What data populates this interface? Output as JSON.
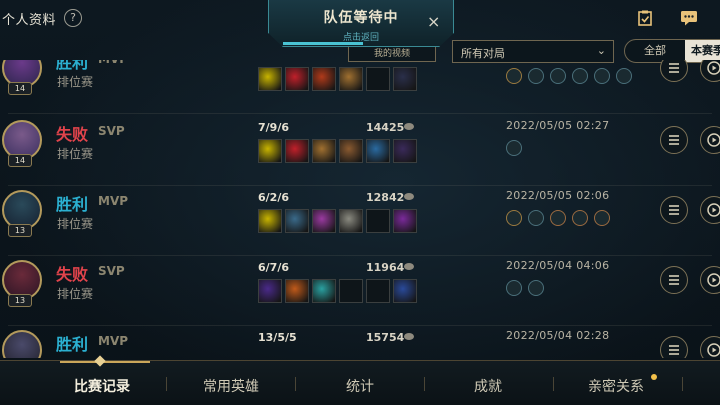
{
  "header": {
    "title": "个人资料",
    "help_icon": "?",
    "icons": [
      "clipboard-icon",
      "chat-icon"
    ]
  },
  "queue_banner": {
    "title": "队伍等待中",
    "subtitle": "点击返回",
    "close_glyph": "×"
  },
  "filters": {
    "left_chip": "我的视频",
    "dropdown_value": "所有对局",
    "toggle_all": "全部",
    "toggle_season": "本赛季"
  },
  "matches": [
    {
      "result": "胜利",
      "result_type": "win",
      "badge": "MVP",
      "mode": "排位赛",
      "level": "14",
      "kda": "",
      "gold": "",
      "date": "",
      "items": [
        "#c8b400",
        "#c0202a",
        "#b03a1a",
        "#a07030",
        "#0e1519",
        "#2a2f4a"
      ],
      "runes": [
        "#9a7a40",
        "#4a6f7a",
        "#4a6f7a",
        "#4a6f7a",
        "#4a6f7a",
        "#4a6f7a"
      ]
    },
    {
      "result": "失败",
      "result_type": "loss",
      "badge": "SVP",
      "mode": "排位赛",
      "level": "14",
      "kda": "7/9/6",
      "gold": "14425",
      "date": "2022/05/05 02:27",
      "items": [
        "#c8b400",
        "#c0202a",
        "#a07030",
        "#8a5a30",
        "#2a6aa0",
        "#3a2a5a"
      ],
      "runes": [
        "#4a6f7a"
      ]
    },
    {
      "result": "胜利",
      "result_type": "win",
      "badge": "MVP",
      "mode": "排位赛",
      "level": "13",
      "kda": "6/2/6",
      "gold": "12842",
      "date": "2022/05/05 02:06",
      "items": [
        "#c8b400",
        "#3a6a8a",
        "#9a3aa0",
        "#8a8a80",
        "#0e1519",
        "#7a2a9a"
      ],
      "runes": [
        "#9a7a40",
        "#4a6f7a",
        "#9a6a40",
        "#9a6a40",
        "#9a6a40"
      ]
    },
    {
      "result": "失败",
      "result_type": "loss",
      "badge": "SVP",
      "mode": "排位赛",
      "level": "13",
      "kda": "6/7/6",
      "gold": "11964",
      "date": "2022/05/04 04:06",
      "items": [
        "#4a2a8a",
        "#c05a1a",
        "#2aa0a0",
        "#0e1519",
        "#0e1519",
        "#2a4a9a"
      ],
      "runes": [
        "#4a6f7a",
        "#4a6f7a"
      ]
    },
    {
      "result": "胜利",
      "result_type": "win",
      "badge": "MVP",
      "mode": "",
      "level": "",
      "kda": "13/5/5",
      "gold": "15754",
      "date": "2022/05/04 02:28",
      "items": [],
      "runes": []
    }
  ],
  "bottom_nav": {
    "tabs": [
      "比赛记录",
      "常用英雄",
      "统计",
      "成就",
      "亲密关系"
    ],
    "active": "比赛记录"
  },
  "colors": {
    "win": "#2bb0d1",
    "loss": "#e0434b",
    "gold_accent": "#cba65a"
  }
}
